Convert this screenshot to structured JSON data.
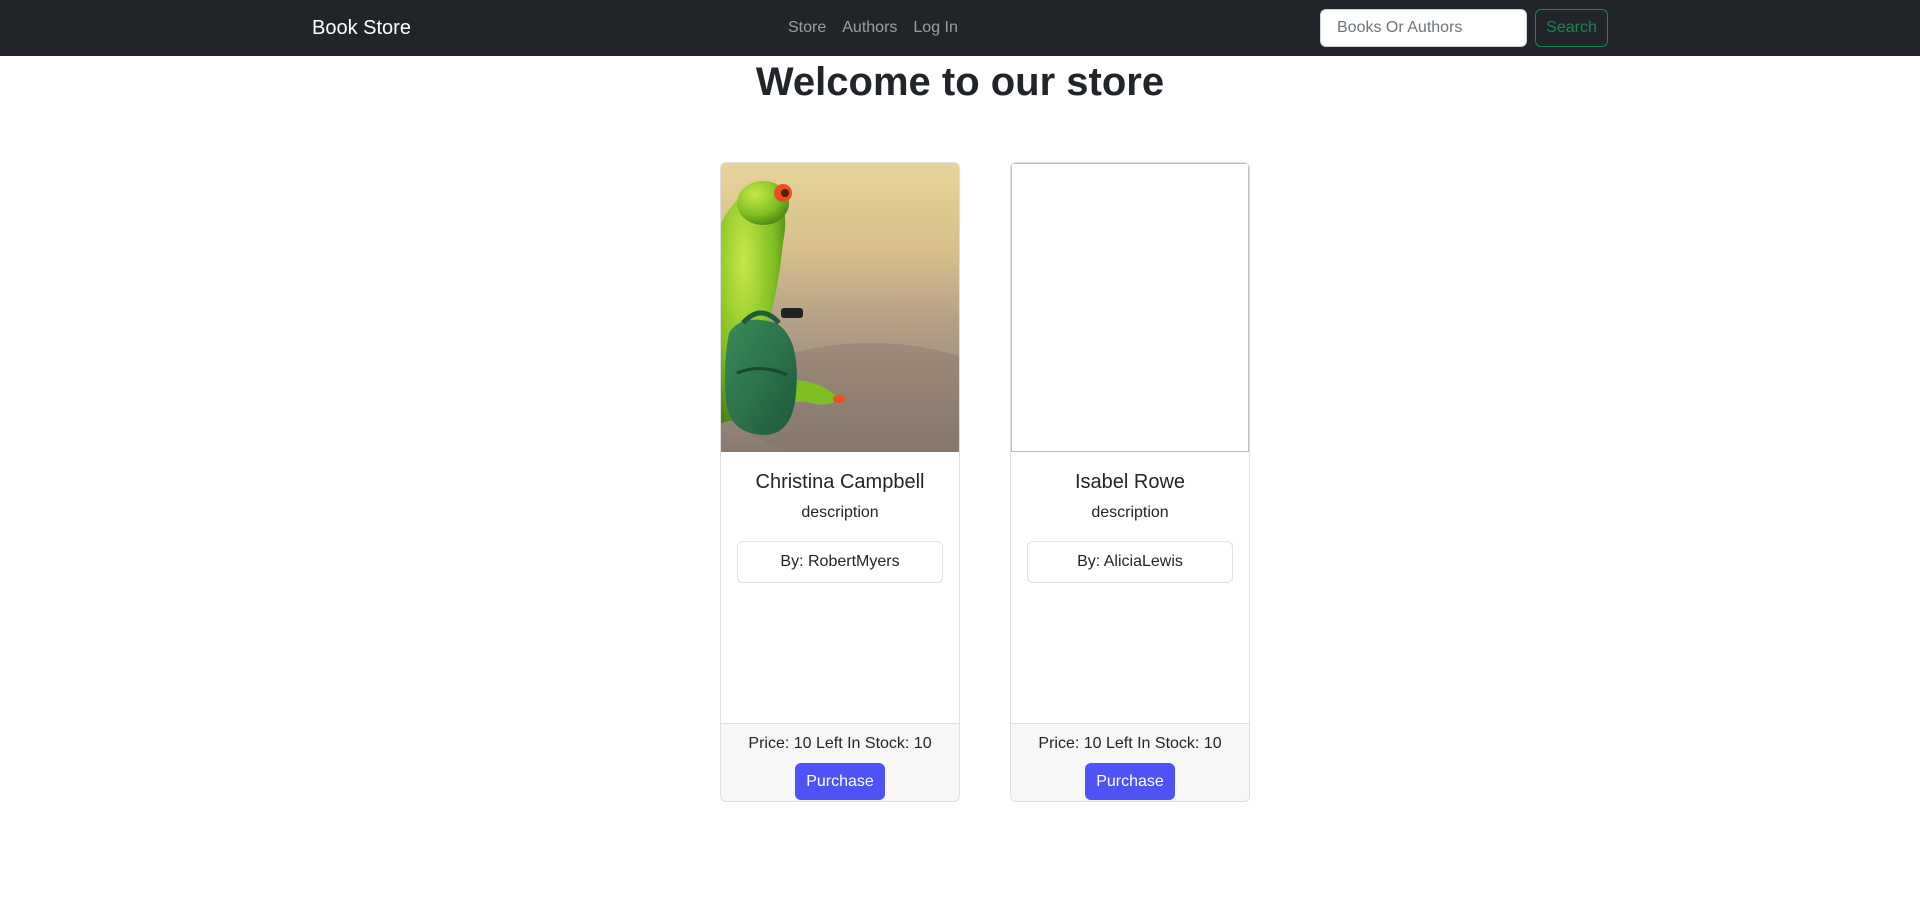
{
  "navbar": {
    "brand": "Book Store",
    "links": [
      {
        "label": "Store"
      },
      {
        "label": "Authors"
      },
      {
        "label": "Log In"
      }
    ],
    "search": {
      "placeholder": "Books Or Authors",
      "value": "",
      "button_label": "Search"
    }
  },
  "main": {
    "title": "Welcome to our store",
    "books": [
      {
        "image": "frog-with-suitcase",
        "title": "Christina Campbell",
        "description": "description",
        "author": "By: RobertMyers",
        "price_stock": "Price: 10 Left In Stock: 10",
        "button_label": "Purchase"
      },
      {
        "image": "",
        "title": "Isabel Rowe",
        "description": "description",
        "author": "By: AliciaLewis",
        "price_stock": "Price: 10 Left In Stock: 10",
        "button_label": "Purchase"
      }
    ]
  },
  "colors": {
    "navbar_bg": "#212529",
    "search_button": "#198754",
    "purchase_button": "#4f53f5"
  }
}
